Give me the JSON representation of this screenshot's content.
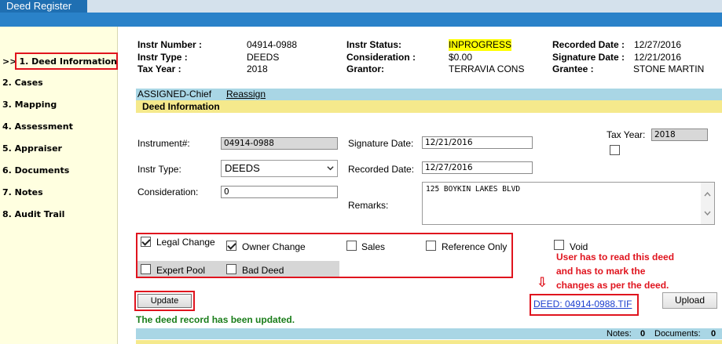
{
  "window": {
    "tab_title": "Deed Register"
  },
  "sidebar": {
    "active_marker": ">>",
    "items": [
      {
        "label": "1. Deed Information"
      },
      {
        "label": "2. Cases"
      },
      {
        "label": "3. Mapping"
      },
      {
        "label": "4. Assessment"
      },
      {
        "label": "5. Appraiser"
      },
      {
        "label": "6. Documents"
      },
      {
        "label": "7. Notes"
      },
      {
        "label": "8. Audit Trail"
      }
    ]
  },
  "header": {
    "instr_number_label": "Instr Number :",
    "instr_number": "04914-0988",
    "instr_type_label": "Instr Type :",
    "instr_type": "DEEDS",
    "tax_year_label": "Tax Year :",
    "tax_year": "2018",
    "instr_status_label": "Instr Status:",
    "instr_status": "INPROGRESS",
    "consideration_label": "Consideration :",
    "consideration": "$0.00",
    "grantor_label": "Grantor:",
    "grantor": "TERRAVIA CONS",
    "recorded_date_label": "Recorded Date :",
    "recorded_date": "12/27/2016",
    "signature_date_label": "Signature Date :",
    "signature_date": "12/21/2016",
    "grantee_label": "Grantee :",
    "grantee": "STONE MARTIN"
  },
  "assignment": {
    "assigned_to": "ASSIGNED-Chief",
    "reassign_label": "Reassign"
  },
  "section_title": "Deed Information",
  "form": {
    "instrument_label": "Instrument#:",
    "instrument_value": "04914-0988",
    "instr_type_label": "Instr Type:",
    "instr_type_value": "DEEDS",
    "consideration_label": "Consideration:",
    "consideration_value": "0",
    "signature_date_label": "Signature Date:",
    "signature_date_value": "12/21/2016",
    "recorded_date_label": "Recorded Date:",
    "recorded_date_value": "12/27/2016",
    "remarks_label": "Remarks:",
    "remarks_value": "125 BOYKIN LAKES BLVD",
    "tax_year_label": "Tax Year:",
    "tax_year_value": "2018",
    "tax_year_checked": false
  },
  "checkboxes": {
    "legal_change": {
      "label": "Legal Change",
      "checked": true
    },
    "owner_change": {
      "label": "Owner Change",
      "checked": true
    },
    "sales": {
      "label": "Sales",
      "checked": false
    },
    "reference_only": {
      "label": "Reference Only",
      "checked": false
    },
    "expert_pool": {
      "label": "Expert Pool",
      "checked": false
    },
    "bad_deed": {
      "label": "Bad Deed",
      "checked": false
    },
    "void": {
      "label": "Void",
      "checked": false
    }
  },
  "annotation": {
    "lines": [
      "User has to read this deed",
      "and has to mark the",
      "changes as per the deed."
    ],
    "arrow_glyph": "⇩"
  },
  "actions": {
    "update_label": "Update",
    "upload_label": "Upload"
  },
  "document_link": "DEED: 04914-0988.TIF",
  "status_message": "The deed record has been updated.",
  "footer": {
    "notes_label": "Notes:",
    "notes_count": "0",
    "documents_label": "Documents:",
    "documents_count": "0"
  },
  "colors": {
    "accent_red": "#e0141e",
    "success_green": "#1a7d1a",
    "status_highlight": "#ffff00",
    "sidebar_bg": "#ffffe0",
    "link_blue": "#1c3fcf"
  }
}
